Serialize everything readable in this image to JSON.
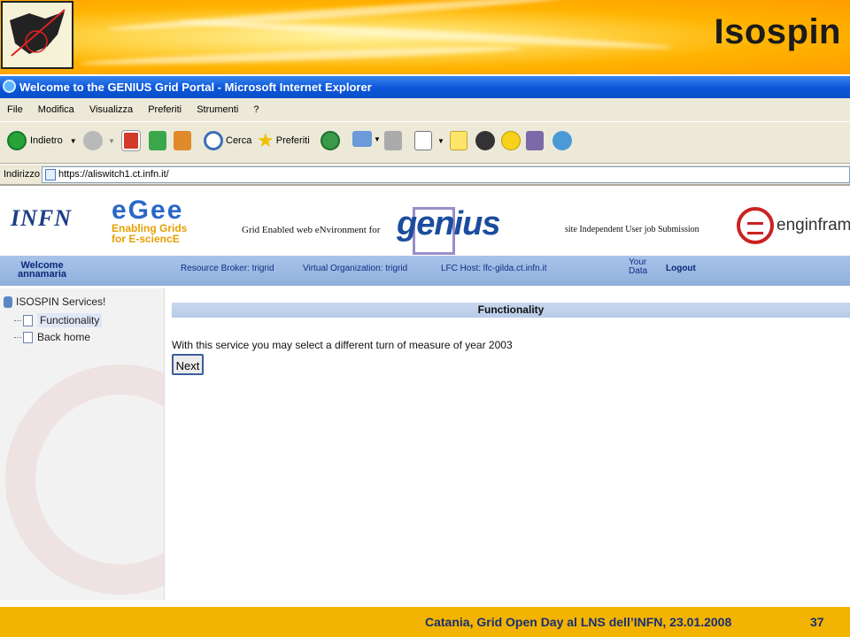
{
  "slide": {
    "title": "Isospin",
    "footer_text": "Catania, Grid Open Day al LNS dell’INFN, 23.01.2008",
    "page_number": "37"
  },
  "browser": {
    "window_title": "Welcome to the GENIUS Grid Portal - Microsoft Internet Explorer",
    "menu": [
      "File",
      "Modifica",
      "Visualizza",
      "Preferiti",
      "Strumenti",
      "?"
    ],
    "toolbar": {
      "back": "Indietro",
      "search": "Cerca",
      "favorites": "Preferiti"
    },
    "address_label": "Indirizzo",
    "address_url": "https://aliswitch1.ct.infn.it/"
  },
  "portal": {
    "infn": "INFN",
    "egee": {
      "logo": "eGee",
      "line1": "Enabling Grids",
      "line2": "for E-sciencE"
    },
    "grid_tagline": "Grid Enabled web eNvironment for",
    "genius": "genius",
    "site_tagline": "site Independent User job Submission",
    "enginframe": "enginframe",
    "welcome": "Welcome",
    "user": "annamaria",
    "resource_broker": "Resource Broker: trigrid",
    "virtual_org": "Virtual Organization: trigrid",
    "lfc_host": "LFC Host: lfc-gilda.ct.infn.it",
    "your_data_1": "Your",
    "your_data_2": "Data",
    "logout": "Logout"
  },
  "tree": {
    "root": "ISOSPIN Services!",
    "items": [
      "Functionality",
      "Back home"
    ]
  },
  "content": {
    "heading": "Functionality",
    "description": "With this service you may select a different turn of measure of year 2003",
    "next_button": "Next"
  },
  "colors": {
    "accent": "#0b55d8",
    "footer": "#f2b400",
    "nav": "#8fb0dc"
  }
}
